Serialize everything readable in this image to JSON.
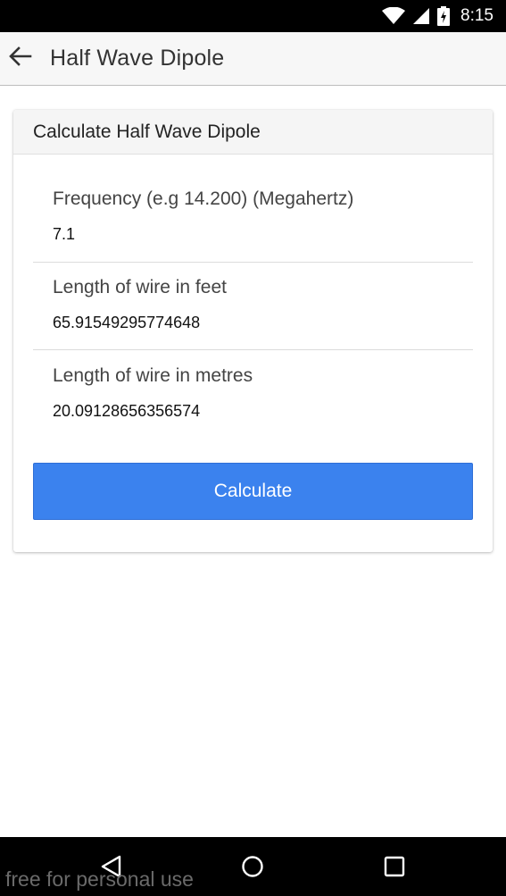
{
  "status_bar": {
    "time": "8:15",
    "icons": [
      "wifi-icon",
      "signal-icon",
      "battery-charging-icon"
    ],
    "background": "#000000"
  },
  "app_bar": {
    "title": "Half Wave Dipole",
    "back_icon": "arrow-left-icon"
  },
  "card": {
    "header": "Calculate Half Wave Dipole",
    "fields": [
      {
        "label": "Frequency (e.g 14.200) (Megahertz)",
        "value": "7.1"
      },
      {
        "label": "Length of wire in feet",
        "value": "65.91549295774648"
      },
      {
        "label": "Length of wire in metres",
        "value": "20.09128656356574"
      }
    ],
    "button_label": "Calculate",
    "button_color": "#3b82ee"
  },
  "nav_bar": {
    "icons": [
      "nav-back-icon",
      "nav-home-icon",
      "nav-recent-apps-icon"
    ]
  },
  "watermark": "free for personal use"
}
